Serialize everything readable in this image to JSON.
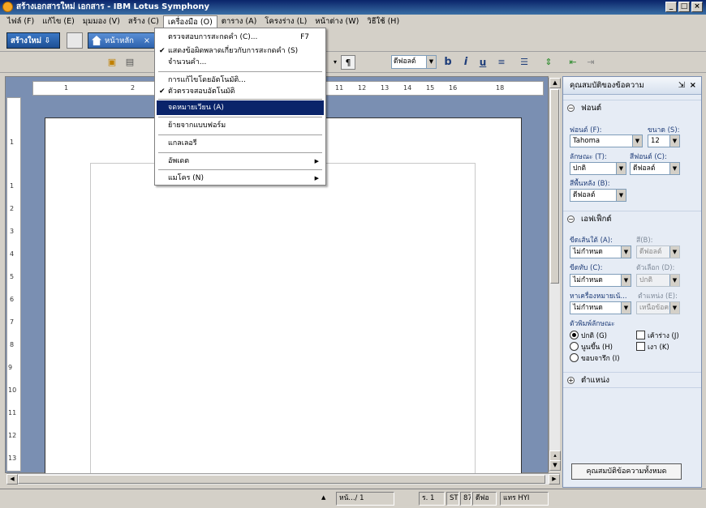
{
  "window": {
    "title": "สร้างเอกสารใหม่  เอกสาร - IBM Lotus Symphony",
    "min": "_",
    "max": "□",
    "close": "×"
  },
  "menubar": [
    "ไฟล์ (F)",
    "แก้ไข (E)",
    "มุมมอง (V)",
    "สร้าง (C)",
    "เครื่องมือ (O)",
    "ตาราง (A)",
    "โครงร่าง (L)",
    "หน้าต่าง (W)",
    "วิธีใช้ (H)"
  ],
  "tabs": {
    "new_button": "สร้างใหม่ ⇩",
    "home_tab": "หน้าหลัก",
    "close": "×"
  },
  "toolbar": {
    "paragraph": "¶",
    "font_style": "ดีฟอลต์",
    "bold": "b",
    "italic": "i",
    "underline": "u"
  },
  "ruler": {
    "h_ticks": [
      "1",
      "2",
      "11",
      "12",
      "13",
      "14",
      "15",
      "16",
      "18"
    ],
    "v_ticks": [
      "1",
      "1",
      "2",
      "3",
      "4",
      "5",
      "6",
      "7",
      "8",
      "9",
      "10",
      "11",
      "12",
      "13"
    ]
  },
  "dropdown": {
    "items": [
      {
        "label": "ตรวจสอบการสะกดคำ (C)...",
        "shortcut": "F7"
      },
      {
        "label": "แสดงข้อผิดพลาดเกี่ยวกับการสะกดคำ (S)",
        "check": "✔"
      },
      {
        "label": "จำนวนคำ..."
      },
      {
        "label": "การแก้ไขโดยอัตโนมัติ..."
      },
      {
        "label": "ตัวตรวจสอบอัตโนมัติ",
        "check": "✔"
      },
      {
        "label": "จดหมายเวียน (A)"
      },
      {
        "label": "ย้ายจากแบบฟอร์ม"
      },
      {
        "label": "แกลเลอรี"
      },
      {
        "label": "อัพเดต",
        "submenu": "▶"
      },
      {
        "label": "แมโคร (N)",
        "submenu": "▶"
      }
    ]
  },
  "sidepanel": {
    "title": "คุณสมบัติของข้อความ",
    "font_section": {
      "title": "ฟอนต์",
      "font_label": "ฟอนต์ (F):",
      "font_value": "Tahoma",
      "size_label": "ขนาด (S):",
      "size_value": "12",
      "style_label": "ลักษณะ (T):",
      "style_value": "ปกติ",
      "color_label": "สีฟอนต์ (C):",
      "color_value": "ดีฟอลต์",
      "bg_label": "สีพื้นหลัง (B):",
      "bg_value": "ดีฟอลต์"
    },
    "effects_section": {
      "title": "เอฟเฟ็กต์",
      "underline_label": "ขีดเส้นใต้ (A):",
      "underline_value": "ไม่กำหนด",
      "ucolor_label": "สี(B):",
      "ucolor_value": "ดีฟอลต์",
      "strike_label": "ขีดทับ (C):",
      "strike_value": "ไม่กำหนด",
      "strike_opt_label": "ตัวเลือก (D):",
      "strike_opt_value": "ปกติ",
      "emph_label": "หาเครื่องหมายเน้...",
      "emph_value": "ไม่กำหนด",
      "emph_pos_label": "ตำแหน่ง (E):",
      "emph_pos_value": "เหนือข้อความ",
      "case_label": "ตัวพิมพ์ลักษณะ",
      "radios": [
        "ปกติ (G)",
        "นูนขึ้น (H)",
        "ขอบจารึก (I)"
      ],
      "checks": [
        "เค้าร่าง (J)",
        "เงา (K)"
      ]
    },
    "position_section": {
      "title": "ตำแหน่ง"
    },
    "all_button": "คุณสมบัติข้อความทั้งหมด"
  },
  "statusbar": {
    "page": "หน้.../ 1",
    "zoom": "ร. 1",
    "st": "ST",
    "num": "87",
    "mode": "ดีฟอ",
    "lang": "แทร HYI"
  },
  "colors": {
    "title_bar": "#0a246a",
    "highlight": "#0a246a",
    "panel_bg": "#e6ecf5",
    "doc_bg": "#7a8fb2"
  }
}
